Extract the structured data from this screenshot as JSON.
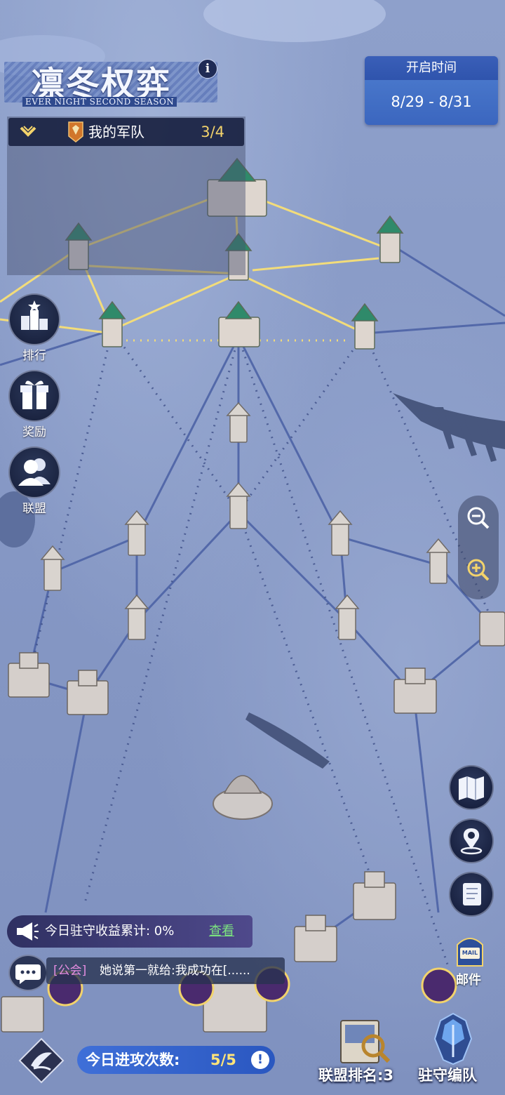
{
  "event": {
    "title": "凛冬权弈",
    "subtitle": "EVER NIGHT SECOND SEASON",
    "info_icon": "i"
  },
  "schedule": {
    "label": "开启时间",
    "dates": "8/29 - 8/31"
  },
  "army": {
    "label": "我的军队",
    "count": "3/4"
  },
  "side_menu": [
    {
      "label": "排行",
      "icon": "podium-icon"
    },
    {
      "label": "奖励",
      "icon": "gift-icon"
    },
    {
      "label": "联盟",
      "icon": "alliance-icon"
    }
  ],
  "zoom": {
    "out_icon": "zoom-out-icon",
    "in_icon": "zoom-in-icon"
  },
  "right_menu": [
    {
      "icon": "map-icon"
    },
    {
      "icon": "location-icon"
    },
    {
      "icon": "scroll-icon"
    }
  ],
  "income": {
    "text": "今日驻守收益累计: 0%",
    "link": "查看"
  },
  "chat": {
    "channel": "[公会]",
    "message": "她说第一就给:我成功在[......"
  },
  "attack": {
    "label": "今日进攻次数:",
    "count": "5/5",
    "alert": "!"
  },
  "bottom": {
    "mail": "邮件",
    "mail_badge": "MAIL",
    "alliance_rank": "联盟排名:3",
    "garrison": "驻守编队"
  },
  "colors": {
    "accent_gold": "#f3d36b",
    "accent_blue": "#3f6fd8",
    "link_green": "#7be37f"
  }
}
